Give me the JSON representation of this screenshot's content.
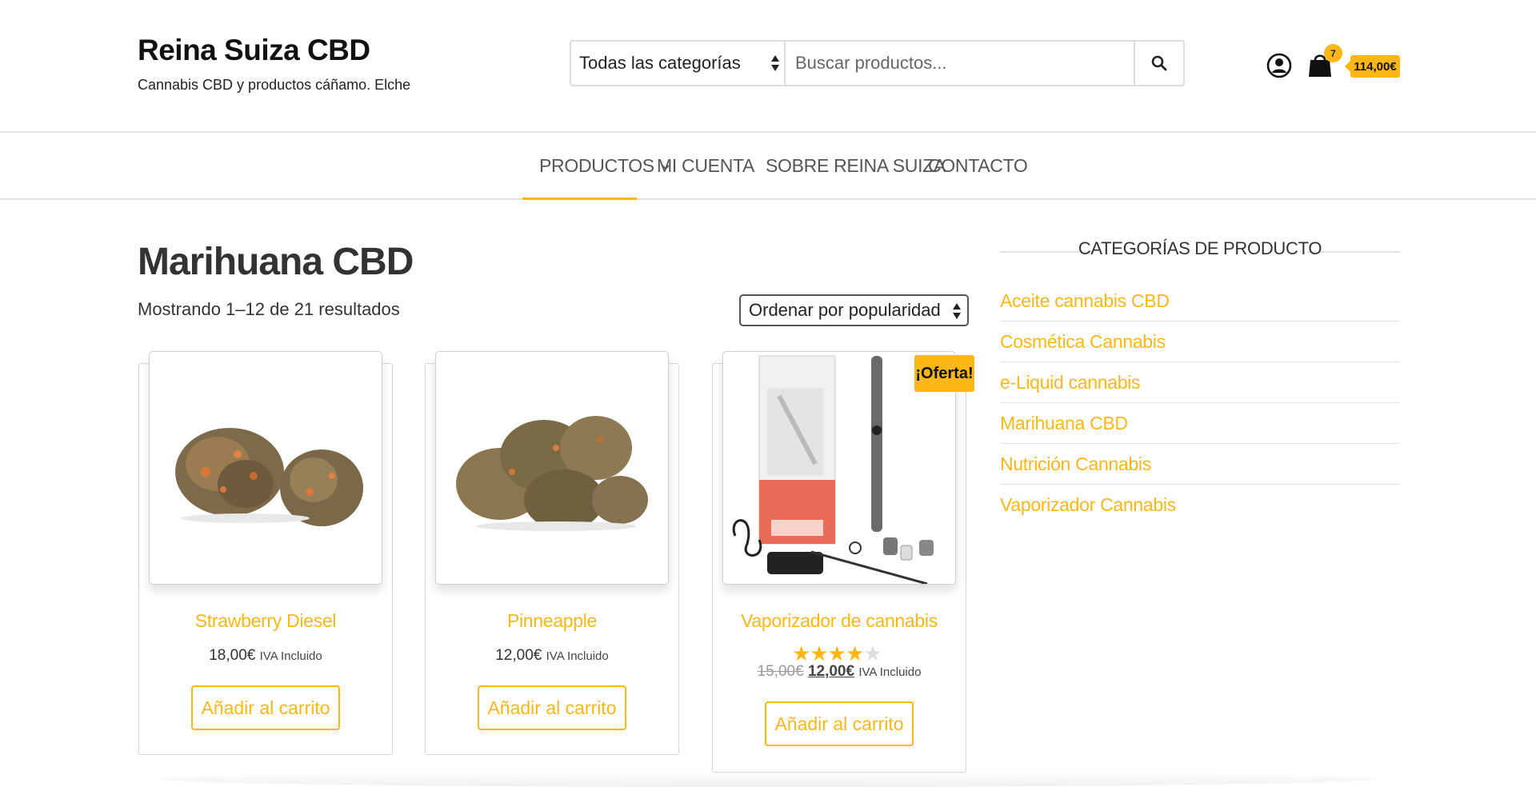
{
  "site": {
    "title": "Reina Suiza CBD",
    "tagline": "Cannabis CBD y productos cáñamo. Elche"
  },
  "search": {
    "category": "Todas las categorías",
    "placeholder": "Buscar productos...",
    "button_icon": "search-icon"
  },
  "header_icons": {
    "account_icon": "user-circle-icon",
    "cart_icon": "shopping-bag-icon",
    "cart_count": "7",
    "cart_total": "114,00€"
  },
  "nav": {
    "items": [
      {
        "label": "PRODUCTOS",
        "active": true,
        "has_dropdown": true
      },
      {
        "label": "MI CUENTA"
      },
      {
        "label": "SOBRE REINA SUIZA"
      },
      {
        "label": "CONTACTO"
      }
    ]
  },
  "main": {
    "title": "Marihuana CBD",
    "results": "Mostrando 1–12 de 21 resultados",
    "sort": "Ordenar por popularidad"
  },
  "products": [
    {
      "name": "Strawberry Diesel",
      "price": "18,00€",
      "tax": "IVA Incluido",
      "button": "Añadir al carrito"
    },
    {
      "name": "Pinneapple",
      "price": "12,00€",
      "tax": "IVA Incluido",
      "button": "Añadir al carrito"
    },
    {
      "name": "Vaporizador de cannabis",
      "badge": "¡Oferta!",
      "rating": 4.5,
      "old_price": "15,00€",
      "price": "12,00€",
      "tax": "IVA Incluido",
      "button": "Añadir al carrito"
    }
  ],
  "sidebar": {
    "title": "CATEGORÍAS DE PRODUCTO",
    "categories": [
      "Aceite cannabis CBD",
      "Cosmética Cannabis",
      "e-Liquid cannabis",
      "Marihuana CBD",
      "Nutrición Cannabis",
      "Vaporizador Cannabis"
    ]
  },
  "colors": {
    "accent": "#fdb715",
    "text": "#333333",
    "border": "#e3e3e3"
  }
}
